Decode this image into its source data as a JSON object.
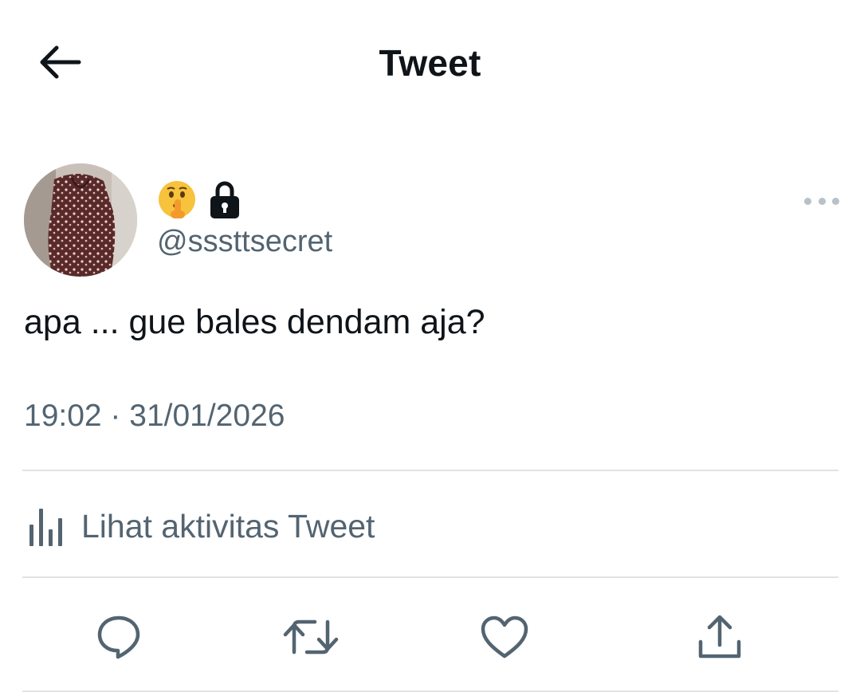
{
  "header": {
    "title": "Tweet",
    "back_icon": "arrow-left-icon"
  },
  "author": {
    "display_name_icons": [
      "shushing-face-emoji",
      "lock-icon"
    ],
    "handle": "@sssttsecret",
    "avatar": "profile-photo"
  },
  "tweet": {
    "text": "apa ... gue bales dendam aja?",
    "timestamp": "19:02 · 31/01/2026"
  },
  "activity": {
    "label": "Lihat aktivitas Tweet",
    "icon": "bar-chart-icon"
  },
  "actions": [
    {
      "name": "reply",
      "icon": "reply-icon"
    },
    {
      "name": "retweet",
      "icon": "retweet-icon"
    },
    {
      "name": "like",
      "icon": "heart-icon"
    },
    {
      "name": "share",
      "icon": "share-icon"
    }
  ],
  "colors": {
    "text_primary": "#0f1419",
    "text_secondary": "#536471",
    "divider": "#dfe3e6",
    "more_dots": "#b9c1c8"
  }
}
